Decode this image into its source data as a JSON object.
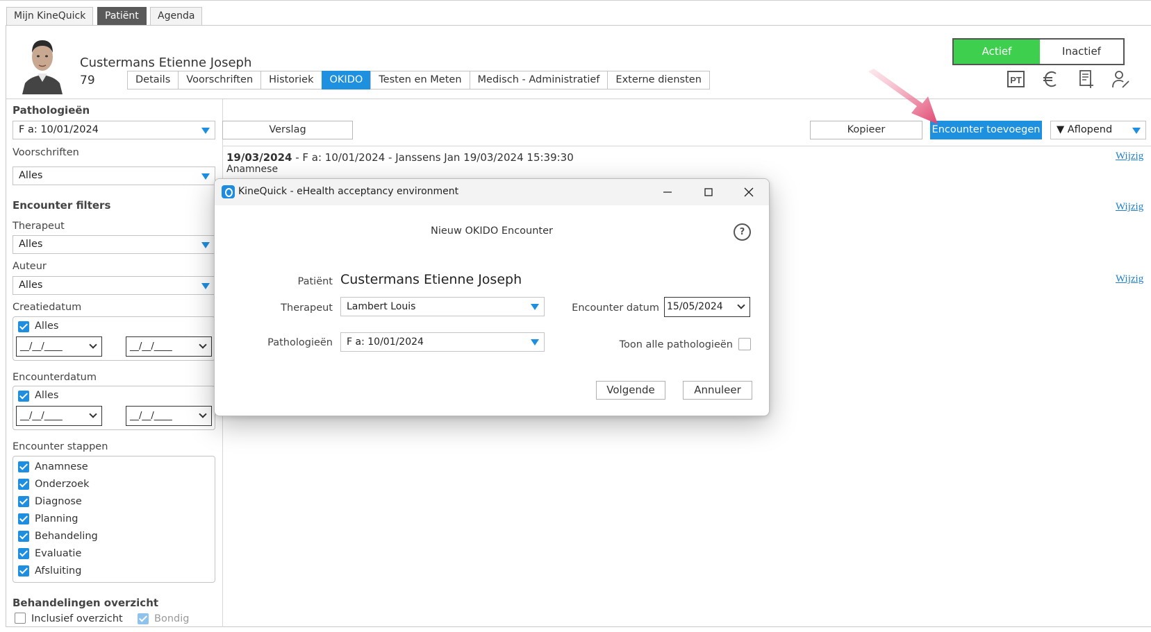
{
  "top_tabs": [
    "Mijn KineQuick",
    "Patiënt",
    "Agenda"
  ],
  "patient": {
    "name": "Custermans Etienne Joseph",
    "number": "79"
  },
  "sub_tabs": [
    "Details",
    "Voorschriften",
    "Historiek",
    "OKIDO",
    "Testen en Meten",
    "Medisch - Administratief",
    "Externe diensten"
  ],
  "active_sub_tab": "OKIDO",
  "status": {
    "active": "Actief",
    "inactive": "Inactief"
  },
  "header_icons": [
    "pt-icon",
    "euro-icon",
    "document-add-icon",
    "user-edit-icon"
  ],
  "sidebar": {
    "pathologieen_title": "Pathologieën",
    "pathologieen_value": "F a: 10/01/2024",
    "voorschriften_label": "Voorschriften",
    "voorschriften_value": "Alles",
    "encounter_filters_title": "Encounter filters",
    "therapeut_label": "Therapeut",
    "therapeut_value": "Alles",
    "auteur_label": "Auteur",
    "auteur_value": "Alles",
    "creatiedatum_label": "Creatiedatum",
    "creatiedatum_all": "Alles",
    "date_placeholder": "__/__/____",
    "encounterdatum_label": "Encounterdatum",
    "encounterdatum_all": "Alles",
    "stappen_label": "Encounter stappen",
    "stappen": [
      "Anamnese",
      "Onderzoek",
      "Diagnose",
      "Planning",
      "Behandeling",
      "Evaluatie",
      "Afsluiting"
    ],
    "overzicht_title": "Behandelingen overzicht",
    "inclusief_label": "Inclusief overzicht",
    "bondig_label": "Bondig"
  },
  "toolbar": {
    "verslag": "Verslag",
    "kopieer": "Kopieer",
    "encounter_toevoegen": "Encounter toevoegen",
    "sort": "▼ Aflopend"
  },
  "encounter": {
    "date": "19/03/2024",
    "detail": " - F a: 10/01/2024 - Janssens Jan 19/03/2024 15:39:30",
    "step": "Anamnese",
    "edit_label": "Wijzig"
  },
  "dialog": {
    "window_title": "KineQuick - eHealth acceptancy environment",
    "heading": "Nieuw OKIDO Encounter",
    "help": "?",
    "patient_label": "Patiënt",
    "patient_value": "Custermans Etienne Joseph",
    "therapeut_label": "Therapeut",
    "therapeut_value": "Lambert Louis",
    "encounter_datum_label": "Encounter datum",
    "encounter_datum_value": "15/05/2024",
    "pathologieen_label": "Pathologieën",
    "pathologieen_value": "F a: 10/01/2024",
    "toon_alle_label": "Toon alle pathologieën",
    "volgende": "Volgende",
    "annuleer": "Annuleer"
  },
  "colors": {
    "accent": "#1e90e0",
    "status_active": "#3ecf4f",
    "arrow": "#e0456f"
  }
}
